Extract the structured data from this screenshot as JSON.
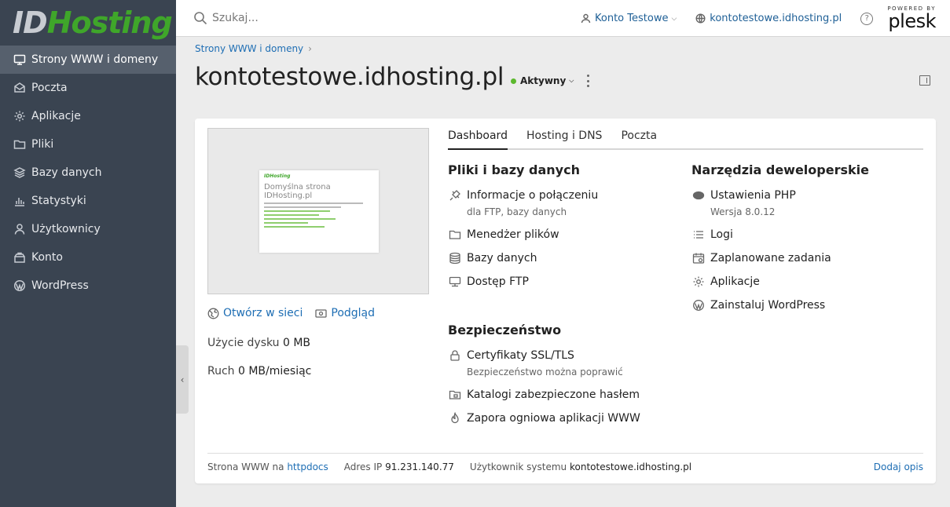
{
  "brand": {
    "logo_part1": "ID",
    "logo_part2": "Hosting",
    "accent": "#3fa62a"
  },
  "sidebar": {
    "items": [
      {
        "label": "Strony WWW i domeny",
        "icon": "monitor-icon"
      },
      {
        "label": "Poczta",
        "icon": "mail-icon"
      },
      {
        "label": "Aplikacje",
        "icon": "gear-icon"
      },
      {
        "label": "Pliki",
        "icon": "folder-icon"
      },
      {
        "label": "Bazy danych",
        "icon": "layers-icon"
      },
      {
        "label": "Statystyki",
        "icon": "bar-chart-icon"
      },
      {
        "label": "Użytkownicy",
        "icon": "user-icon"
      },
      {
        "label": "Konto",
        "icon": "briefcase-icon"
      },
      {
        "label": "WordPress",
        "icon": "wordpress-icon"
      }
    ]
  },
  "topbar": {
    "search_placeholder": "Szukaj...",
    "account_label": "Konto Testowe",
    "domain_link": "kontotestowe.idhosting.pl",
    "help": "?",
    "powered_by": "POWERED BY",
    "plesk": "plesk"
  },
  "header": {
    "breadcrumb": "Strony WWW i domeny",
    "title": "kontotestowe.idhosting.pl",
    "status": "Aktywny",
    "status_color": "#5cb82e"
  },
  "preview": {
    "thumb_logo": "IDHosting",
    "thumb_title": "Domyślna strona IDHosting.pl"
  },
  "site_links": {
    "open": "Otwórz w sieci",
    "preview": "Podgląd"
  },
  "stats": {
    "disk_label": "Użycie dysku",
    "disk_value": "0 MB",
    "traffic_label": "Ruch",
    "traffic_value": "0 MB/miesiąc"
  },
  "tabs": [
    {
      "label": "Dashboard"
    },
    {
      "label": "Hosting i DNS"
    },
    {
      "label": "Poczta"
    }
  ],
  "files_section": {
    "title": "Pliki i bazy danych",
    "items": [
      {
        "label": "Informacje o połączeniu",
        "sub": "dla FTP, bazy danych"
      },
      {
        "label": "Menedżer plików"
      },
      {
        "label": "Bazy danych"
      },
      {
        "label": "Dostęp FTP"
      }
    ]
  },
  "security_section": {
    "title": "Bezpieczeństwo",
    "items": [
      {
        "label": "Certyfikaty SSL/TLS",
        "sub": "Bezpieczeństwo można poprawić"
      },
      {
        "label": "Katalogi zabezpieczone hasłem"
      },
      {
        "label": "Zapora ogniowa aplikacji WWW"
      }
    ]
  },
  "dev_section": {
    "title": "Narzędzia deweloperskie",
    "items": [
      {
        "label": "Ustawienia PHP",
        "sub": "Wersja 8.0.12"
      },
      {
        "label": "Logi"
      },
      {
        "label": "Zaplanowane zadania"
      },
      {
        "label": "Aplikacje"
      },
      {
        "label": "Zainstaluj WordPress"
      }
    ]
  },
  "footer": {
    "site_label": "Strona WWW na",
    "site_value": "httpdocs",
    "ip_label": "Adres IP",
    "ip_value": "91.231.140.77",
    "user_label": "Użytkownik systemu",
    "user_value": "kontotestowe.idhosting.pl",
    "add_desc": "Dodaj opis"
  }
}
